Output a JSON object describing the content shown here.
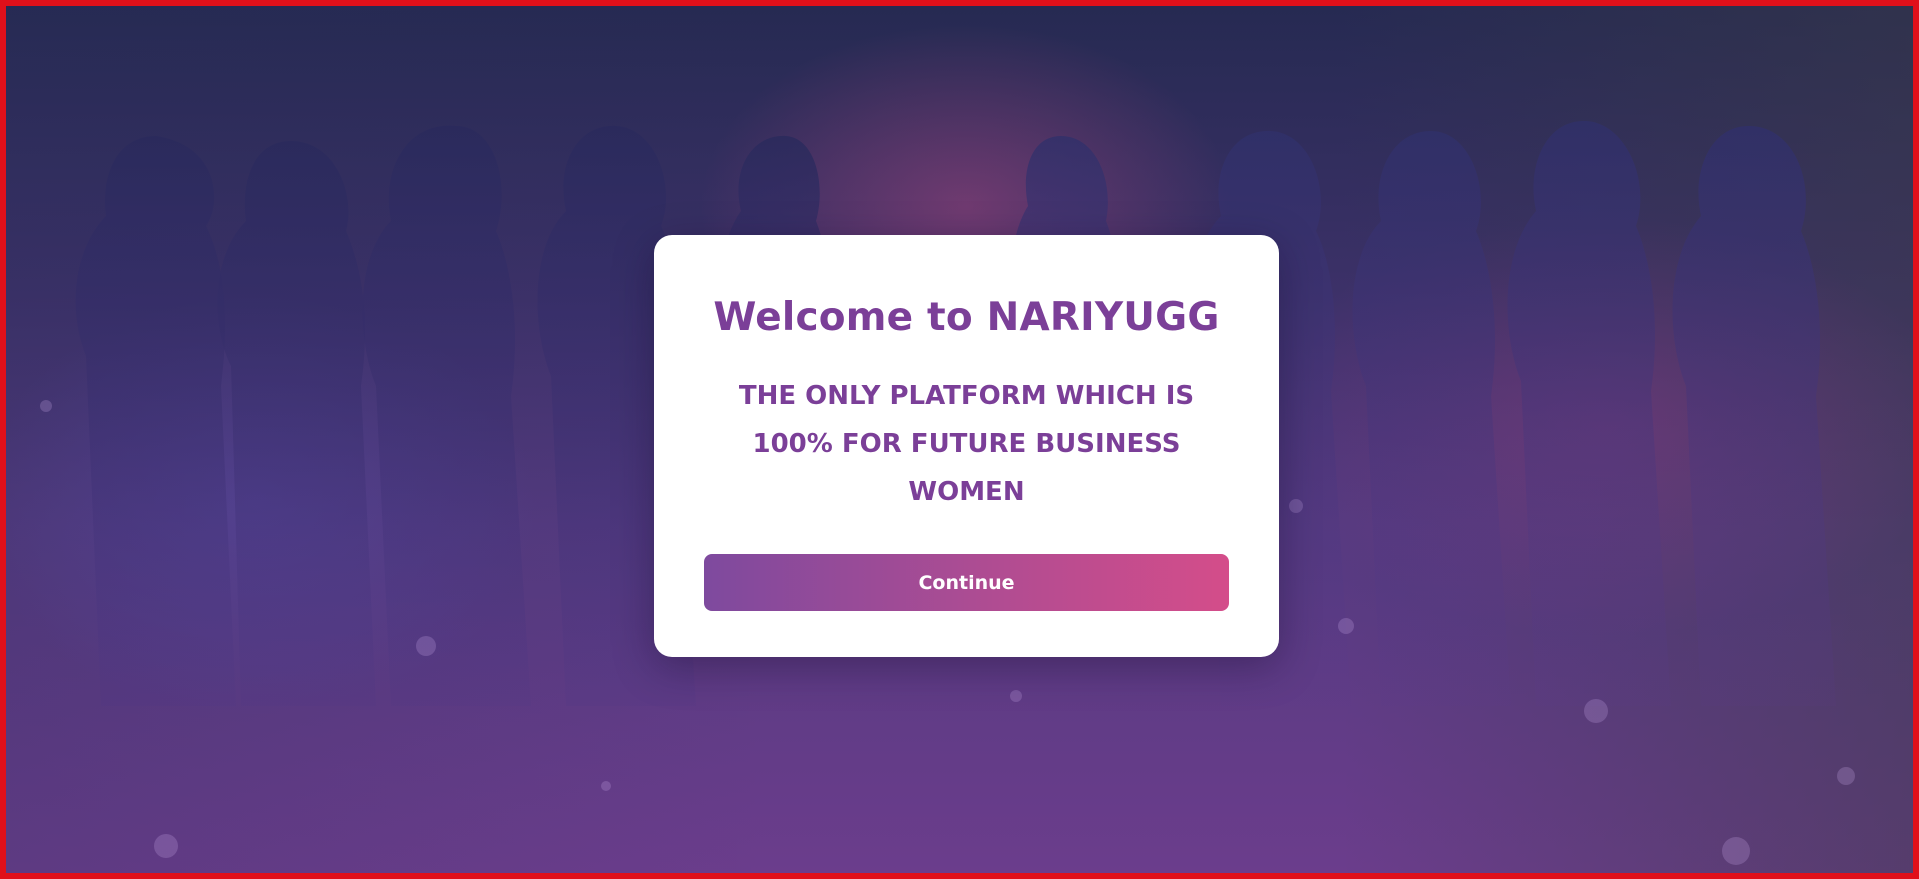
{
  "modal": {
    "title": "Welcome to NARIYUGG",
    "subtitle": "THE ONLY PLATFORM WHICH IS 100% FOR FUTURE BUSINESS WOMEN",
    "continue_label": "Continue"
  },
  "colors": {
    "accent": "#7b3f98",
    "button_start": "#7e4a9e",
    "button_end": "#d44d8a",
    "frame_border": "#e0101a"
  }
}
